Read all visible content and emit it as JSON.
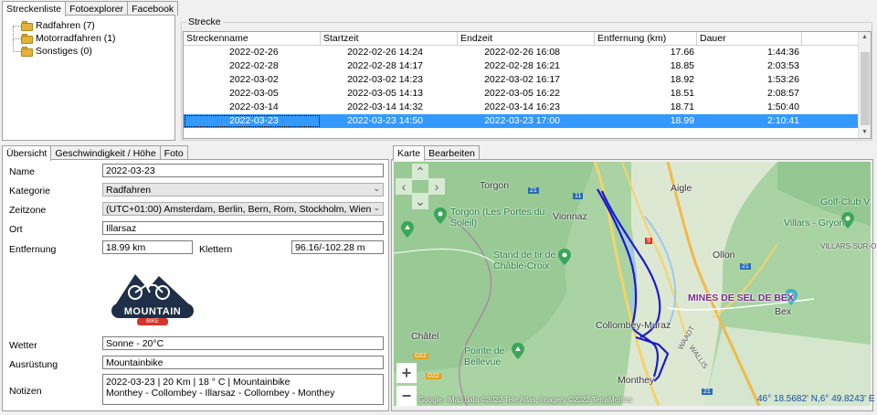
{
  "top_tabs": [
    "Streckenliste",
    "Fotoexplorer",
    "Facebook"
  ],
  "tree": [
    {
      "label": "Radfahren (7)"
    },
    {
      "label": "Motorradfahren (1)"
    },
    {
      "label": "Sonstiges (0)"
    }
  ],
  "strecke": {
    "title": "Strecke",
    "columns": [
      "Streckenname",
      "Startzeit",
      "Endzeit",
      "Entfernung (km)",
      "Dauer"
    ],
    "rows": [
      [
        "2022-02-26",
        "2022-02-26 14:24",
        "2022-02-26 16:08",
        "17.66",
        "1:44:36"
      ],
      [
        "2022-02-28",
        "2022-02-28 14:17",
        "2022-02-28 16:21",
        "18.85",
        "2:03:53"
      ],
      [
        "2022-03-02",
        "2022-03-02 14:23",
        "2022-03-02 16:17",
        "18.92",
        "1:53:26"
      ],
      [
        "2022-03-05",
        "2022-03-05 14:13",
        "2022-03-05 16:22",
        "18.51",
        "2:08:57"
      ],
      [
        "2022-03-14",
        "2022-03-14 14:32",
        "2022-03-14 16:23",
        "18.71",
        "1:50:40"
      ],
      [
        "2022-03-23",
        "2022-03-23 14:50",
        "2022-03-23 17:00",
        "18.99",
        "2:10:41"
      ]
    ],
    "selected_row": 5
  },
  "detail_tabs": [
    "Übersicht",
    "Geschwindigkeit / Höhe",
    "Foto"
  ],
  "detail": {
    "name_label": "Name",
    "name_value": "2022-03-23",
    "kategorie_label": "Kategorie",
    "kategorie_value": "Radfahren",
    "zeitzone_label": "Zeitzone",
    "zeitzone_value": "(UTC+01:00) Amsterdam, Berlin, Bern, Rom, Stockholm, Wien",
    "ort_label": "Ort",
    "ort_value": "Illarsaz",
    "entfernung_label": "Entfernung",
    "entfernung_value": "18.99 km",
    "klettern_label": "Klettern",
    "klettern_value": "96.16/-102.28 m",
    "logo_text": "MOUNTAIN",
    "logo_sub": "BIKE",
    "wetter_label": "Wetter",
    "wetter_value": "Sonne  -  20°C",
    "ausruestung_label": "Ausrüstung",
    "ausruestung_value": "Mountainbike",
    "notizen_label": "Notizen",
    "notizen_line1": "2022-03-23 | 20 Km | 18 ° C | Mountainbike",
    "notizen_line2": "Monthey - Collombey - Illarsaz - Collombey - Monthey"
  },
  "map_tabs": [
    "Karte",
    "Bearbeiten"
  ],
  "map": {
    "places": {
      "torgon": "Torgon",
      "torgon_poi": "Torgon (Les Portes du Soleil)",
      "vionnaz": "Vionnaz",
      "aigle": "Aigle",
      "golf": "Golf-Club V",
      "villars": "Villars - Gryon",
      "villars_sur": "VILLARS-SUR-OL",
      "stand": "Stand de tir de Châble-Croix",
      "ollon": "Ollon",
      "mines": "MINES DE SEL DE BEX",
      "bex": "Bex",
      "collombey": "Collombey-Muraz",
      "chatel": "Châtel",
      "pointe": "Pointe de Bellevue",
      "monthey": "Monthey",
      "waadt": "WAADT",
      "wallis": "WALLIS"
    },
    "road_labels": [
      "21",
      "11",
      "9",
      "21",
      "D22",
      "D22",
      "21"
    ],
    "attribution": "Google - Map data ©2022 Tele Atlas, Imagery ©2022 TerraMetrics",
    "coords": "46° 18.5682' N,6° 49.8243' E",
    "zoom_in": "+",
    "zoom_out": "−",
    "colors": {
      "track": "#1a1acc",
      "poi": "#3aa659",
      "water": "#9dc9ee"
    }
  }
}
